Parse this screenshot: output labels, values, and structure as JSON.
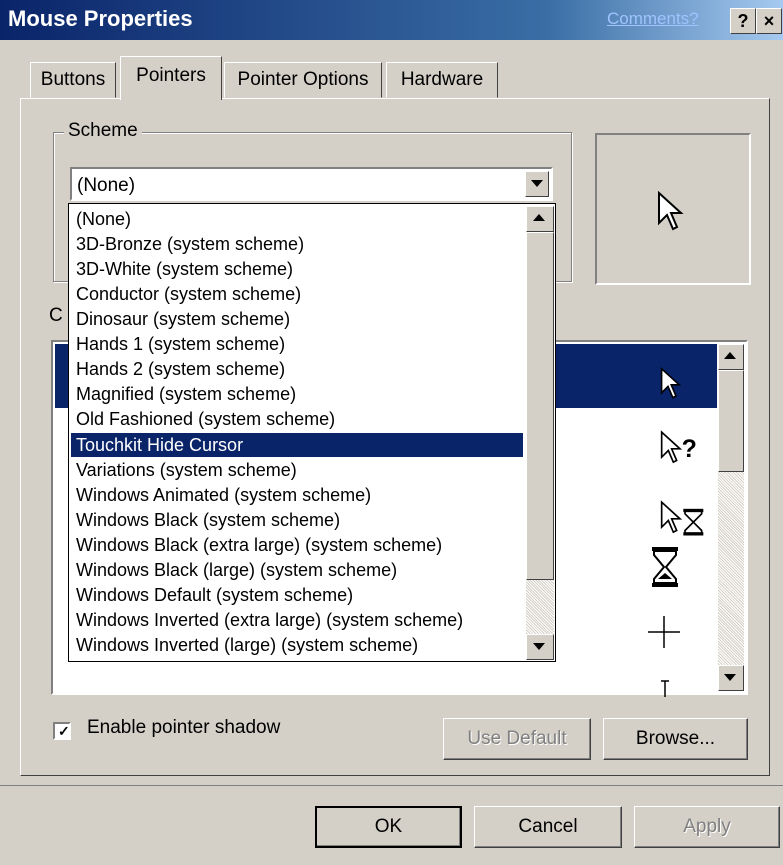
{
  "window": {
    "title": "Mouse Properties",
    "comments_link": "Comments?",
    "help_button": "?",
    "close_button": "×"
  },
  "tabs": [
    {
      "label": "Buttons"
    },
    {
      "label": "Pointers"
    },
    {
      "label": "Pointer Options"
    },
    {
      "label": "Hardware"
    }
  ],
  "scheme": {
    "group_label": "Scheme",
    "selected_value": "(None)"
  },
  "customize": {
    "label_visible_fragment": "C"
  },
  "scheme_dropdown": {
    "items": [
      "(None)",
      "3D-Bronze (system scheme)",
      "3D-White (system scheme)",
      "Conductor (system scheme)",
      "Dinosaur (system scheme)",
      "Hands 1 (system scheme)",
      "Hands 2 (system scheme)",
      "Magnified (system scheme)",
      "Old Fashioned (system scheme)",
      "Touchkit Hide Cursor",
      "Variations (system scheme)",
      "Windows Animated (system scheme)",
      "Windows Black  (system scheme)",
      "Windows Black (extra large) (system scheme)",
      "Windows Black (large) (system scheme)",
      "Windows Default (system scheme)",
      "Windows Inverted (extra large) (system scheme)",
      "Windows Inverted (large) (system scheme)"
    ],
    "highlighted": "Touchkit Hide Cursor"
  },
  "cursor_icons": [
    "arrow-pointer-icon",
    "help-select-icon",
    "working-in-background-icon",
    "busy-hourglass-icon",
    "precision-crosshair-icon",
    "text-select-icon"
  ],
  "shadow": {
    "label": "Enable pointer shadow",
    "checked": true
  },
  "buttons": {
    "use_default": "Use Default",
    "browse": "Browse...",
    "ok": "OK",
    "cancel": "Cancel",
    "apply": "Apply"
  },
  "colors": {
    "selection": "#0a246a",
    "face": "#d4d0c8"
  }
}
